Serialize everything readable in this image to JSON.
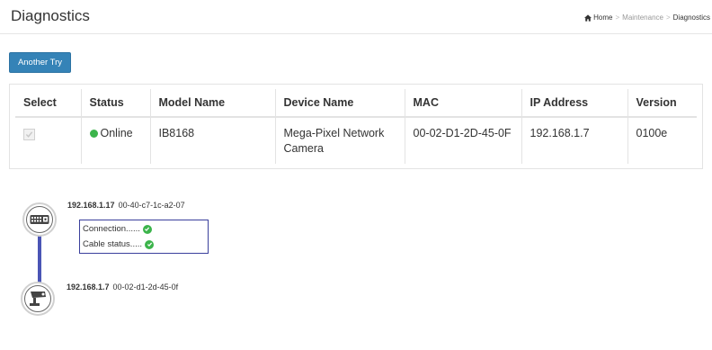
{
  "header": {
    "title": "Diagnostics",
    "breadcrumb": {
      "home": "Home",
      "parent": "Maintenance",
      "current": "Diagnostics",
      "separator": ">"
    }
  },
  "actions": {
    "another_try": "Another Try"
  },
  "table": {
    "columns": [
      "Select",
      "Status",
      "Model Name",
      "Device Name",
      "MAC",
      "IP Address",
      "Version"
    ],
    "rows": [
      {
        "selected": true,
        "status": "Online",
        "model": "IB8168",
        "device": "Mega-Pixel Network Camera",
        "mac": "00-02-D1-2D-45-0F",
        "ip": "192.168.1.7",
        "version": "0100e"
      }
    ]
  },
  "diagram": {
    "switch": {
      "ip": "192.168.1.17",
      "mac": "00-40-c7-1c-a2-07",
      "icon": "switch-icon"
    },
    "camera": {
      "ip": "192.168.1.7",
      "mac": "00-02-d1-2d-45-0f",
      "icon": "camera-icon"
    },
    "status": {
      "connection": "Connection......",
      "cable": "Cable status....."
    }
  },
  "colors": {
    "button": "#3583b7",
    "online": "#3cb44b",
    "link": "#4a55b5",
    "status_border": "#3a3f9c"
  }
}
